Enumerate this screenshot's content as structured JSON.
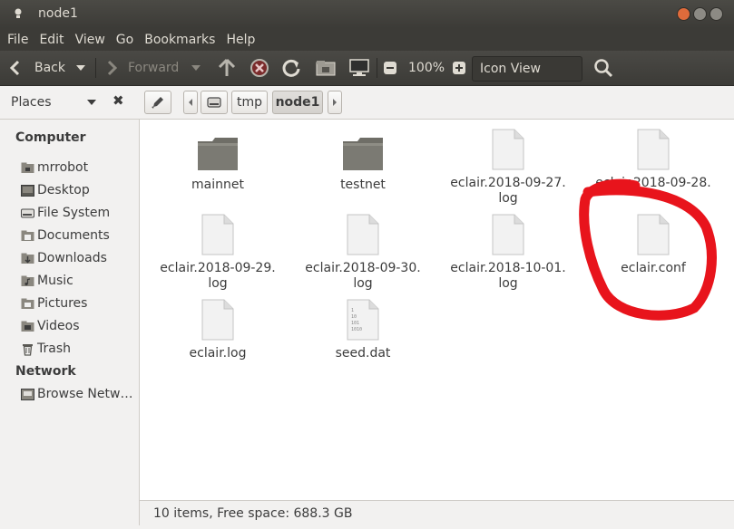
{
  "window": {
    "title": "node1"
  },
  "menu": [
    "File",
    "Edit",
    "View",
    "Go",
    "Bookmarks",
    "Help"
  ],
  "toolbar": {
    "back_label": "Back",
    "forward_label": "Forward",
    "zoom_level": "100%",
    "view_mode": "Icon View"
  },
  "places": {
    "label": "Places"
  },
  "breadcrumb": [
    "tmp",
    "node1"
  ],
  "sidebar": {
    "computer_heading": "Computer",
    "computer_items": [
      {
        "label": "mrrobot",
        "icon": "home-folder-icon"
      },
      {
        "label": "Desktop",
        "icon": "desktop-icon"
      },
      {
        "label": "File System",
        "icon": "drive-icon"
      },
      {
        "label": "Documents",
        "icon": "documents-icon"
      },
      {
        "label": "Downloads",
        "icon": "downloads-icon"
      },
      {
        "label": "Music",
        "icon": "music-icon"
      },
      {
        "label": "Pictures",
        "icon": "pictures-icon"
      },
      {
        "label": "Videos",
        "icon": "videos-icon"
      },
      {
        "label": "Trash",
        "icon": "trash-icon"
      }
    ],
    "network_heading": "Network",
    "network_items": [
      {
        "label": "Browse Netw…",
        "icon": "network-icon"
      }
    ]
  },
  "files": [
    {
      "name": "mainnet",
      "type": "folder"
    },
    {
      "name": "testnet",
      "type": "folder"
    },
    {
      "name": "eclair.2018-09-27.\nlog",
      "type": "file"
    },
    {
      "name": "eclair.2018-09-28.",
      "type": "file"
    },
    {
      "name": "eclair.2018-09-29.\nlog",
      "type": "file"
    },
    {
      "name": "eclair.2018-09-30.\nlog",
      "type": "file"
    },
    {
      "name": "eclair.2018-10-01.\nlog",
      "type": "file"
    },
    {
      "name": "eclair.conf",
      "type": "file"
    },
    {
      "name": "eclair.log",
      "type": "file"
    },
    {
      "name": "seed.dat",
      "type": "binary"
    }
  ],
  "status": {
    "text": "10 items, Free space: 688.3 GB"
  },
  "colors": {
    "annotation": "#e8141c",
    "titlebar": "#3c3b37",
    "folder": "#7b7a73"
  }
}
